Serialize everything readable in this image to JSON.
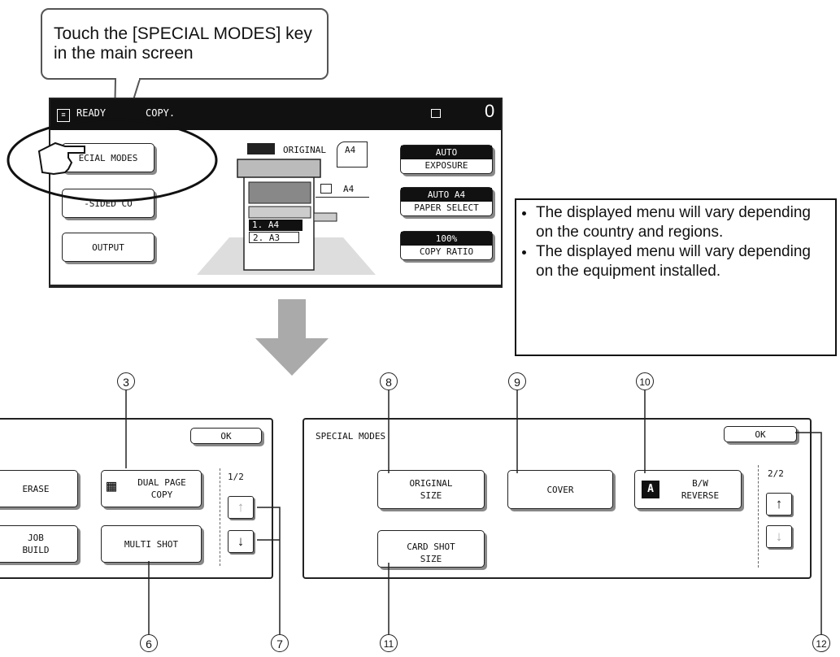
{
  "callout": {
    "text": "Touch the [SPECIAL MODES] key in the main screen"
  },
  "main_screen": {
    "status": "READY",
    "mode": "COPY.",
    "count": "0",
    "special_modes": "ECIAL MODES",
    "two_sided": "-SIDED CO",
    "output": "OUTPUT",
    "original_label": "ORIGINAL",
    "original_size": "A4",
    "tray_size": "A4",
    "tray1": "1.  A4",
    "tray2": "2.  A3",
    "exposure_value": "AUTO",
    "exposure_label": "EXPOSURE",
    "paper_value": "AUTO    A4",
    "paper_label": "PAPER SELECT",
    "ratio_value": "100%",
    "ratio_label": "COPY RATIO"
  },
  "note": {
    "items": [
      "The displayed menu will vary depending on the country and regions.",
      "The displayed menu will vary depending on the equipment installed."
    ]
  },
  "page1": {
    "ok": "OK",
    "erase": "ERASE",
    "dual_page_1": "DUAL PAGE",
    "dual_page_2": "COPY",
    "job_1": "JOB",
    "job_2": "BUILD",
    "multi_shot": "MULTI SHOT",
    "page": "1/2"
  },
  "page2": {
    "title": "SPECIAL MODES",
    "ok": "OK",
    "orig_1": "ORIGINAL",
    "orig_2": "SIZE",
    "cover": "COVER",
    "bw_1": "B/W",
    "bw_2": "REVERSE",
    "card_1": "CARD SHOT",
    "card_2": "SIZE",
    "page": "2/2"
  },
  "numbers": {
    "n3": "3",
    "n6": "6",
    "n7": "7",
    "n8": "8",
    "n9": "9",
    "n10": "10",
    "n11": "11",
    "n12": "12"
  }
}
